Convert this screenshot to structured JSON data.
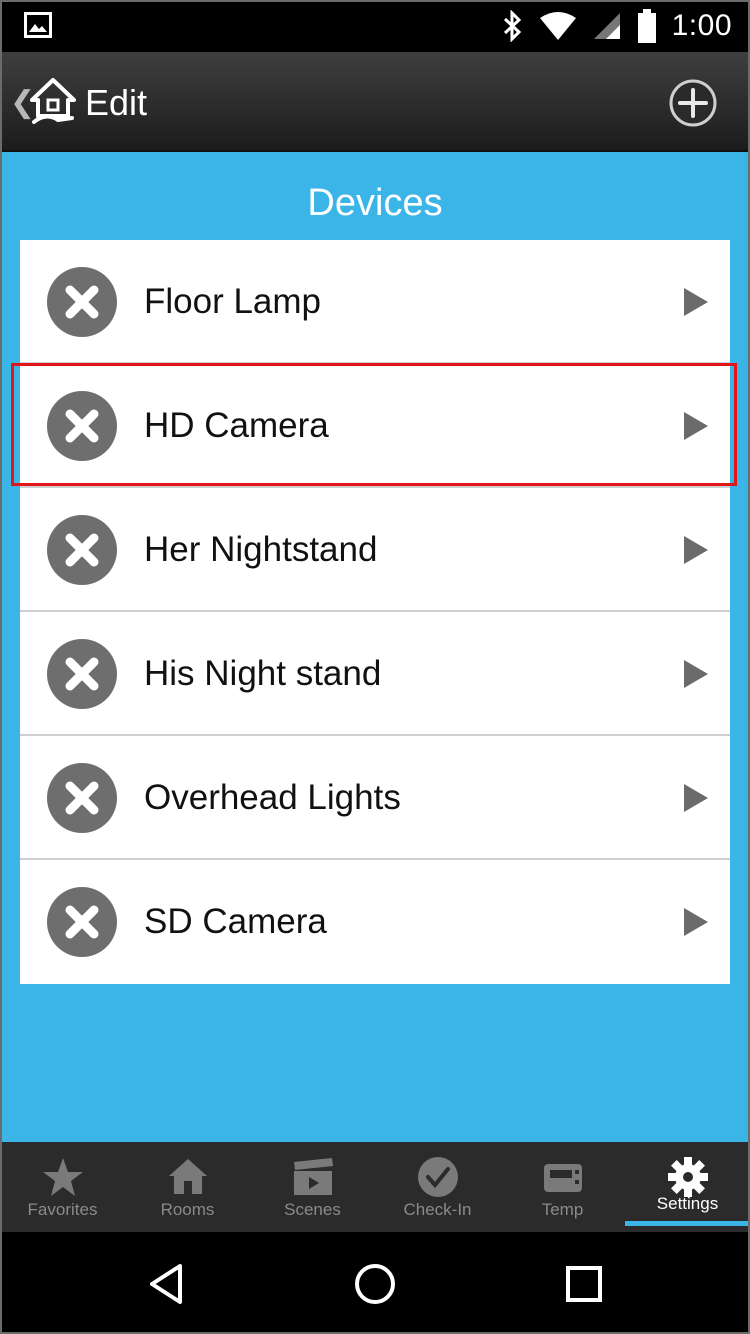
{
  "status_bar": {
    "time": "1:00"
  },
  "action_bar": {
    "back_icon": "chevron-left-icon",
    "home_icon": "home-icon",
    "title": "Edit",
    "add_icon": "plus-circle-icon"
  },
  "section_title": "Devices",
  "devices": [
    {
      "name": "Floor Lamp"
    },
    {
      "name": "HD Camera",
      "highlighted": true
    },
    {
      "name": "Her Nightstand"
    },
    {
      "name": "His Night stand"
    },
    {
      "name": "Overhead Lights"
    },
    {
      "name": "SD Camera"
    }
  ],
  "tabs": [
    {
      "label": "Favorites",
      "icon": "star-icon"
    },
    {
      "label": "Rooms",
      "icon": "house-icon"
    },
    {
      "label": "Scenes",
      "icon": "clapperboard-icon"
    },
    {
      "label": "Check-In",
      "icon": "check-icon"
    },
    {
      "label": "Temp",
      "icon": "thermostat-icon"
    },
    {
      "label": "Settings",
      "icon": "gear-icon",
      "active": true
    }
  ],
  "colors": {
    "accent": "#3bb5e8",
    "highlight": "#e0161b"
  }
}
